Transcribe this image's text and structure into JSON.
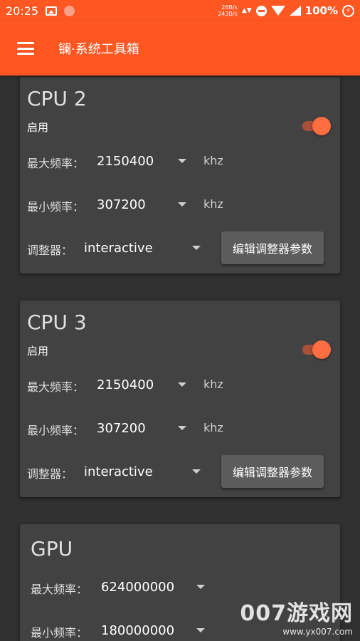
{
  "status_bar": {
    "time": "20:25",
    "net_up": "26B/s",
    "net_down": "243B/s",
    "battery": "100%"
  },
  "app_bar": {
    "title": "镧·系统工具箱"
  },
  "cpu_cards": [
    {
      "title": "CPU 2",
      "enable_label": "启用",
      "enabled": true,
      "max_label": "最大频率：",
      "max_value": "2150400",
      "min_label": "最小频率：",
      "min_value": "307200",
      "unit": "khz",
      "governor_label": "调整器：",
      "governor_value": "interactive",
      "edit_button": "编辑调整器参数"
    },
    {
      "title": "CPU 3",
      "enable_label": "启用",
      "enabled": true,
      "max_label": "最大频率：",
      "max_value": "2150400",
      "min_label": "最小频率：",
      "min_value": "307200",
      "unit": "khz",
      "governor_label": "调整器：",
      "governor_value": "interactive",
      "edit_button": "编辑调整器参数"
    }
  ],
  "gpu_card": {
    "title": "GPU",
    "max_label": "最大频率：",
    "max_value": "624000000",
    "min_label": "最小频率：",
    "min_value": "180000000"
  },
  "watermark": {
    "brand": "007游戏网",
    "url": "www.yx007.com"
  },
  "colors": {
    "accent": "#ff5722",
    "background": "#303030",
    "card": "#424242"
  }
}
